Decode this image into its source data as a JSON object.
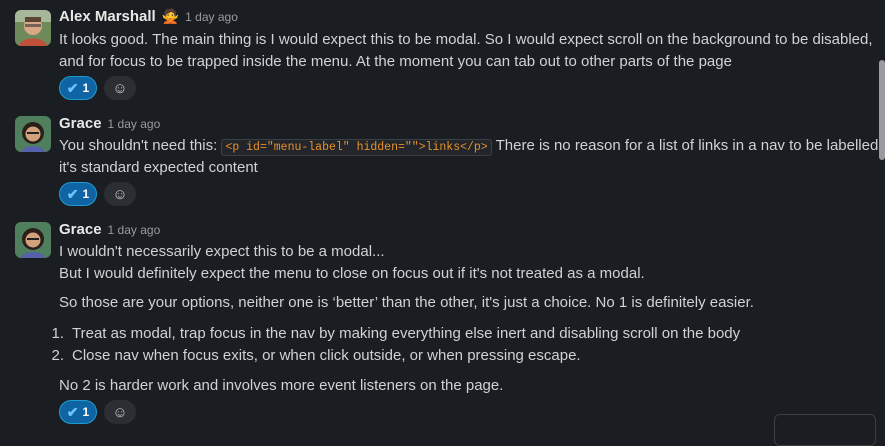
{
  "messages": [
    {
      "author": "Alex Marshall",
      "status_emoji": "🙅",
      "time": "1 day ago",
      "lines": [
        "It looks good. The main thing is I would expect this to be modal. So I would expect scroll on the background to be disabled,",
        "and for focus to be trapped inside the menu. At the moment you can tab out to other parts of the page"
      ],
      "reaction_count": "1"
    },
    {
      "author": "Grace",
      "time": "1 day ago",
      "line1_before": "You shouldn't need this:",
      "code": "<p id=\"menu-label\" hidden=\"\">links</p>",
      "line1_after": "There is no reason for a list of links in a nav to be labelled,",
      "line2": "it's standard expected content",
      "reaction_count": "1"
    },
    {
      "author": "Grace",
      "time": "1 day ago",
      "lines": [
        "I wouldn't necessarily expect this to be a modal...",
        "But I would definitely expect the menu to close on focus out if it's not treated as a modal.",
        "So those are your options, neither one is ‘better’ than the other, it's just a choice. No 1 is definitely easier."
      ],
      "list": [
        {
          "num": "1.",
          "text": "Treat as modal, trap focus in the nav by making everything else inert and disabling scroll on the body"
        },
        {
          "num": "2.",
          "text": "Close nav when focus exits, or when click outside, or when pressing escape."
        }
      ],
      "closing": "No 2 is harder work and involves more event listeners on the page.",
      "reaction_count": "1"
    }
  ]
}
